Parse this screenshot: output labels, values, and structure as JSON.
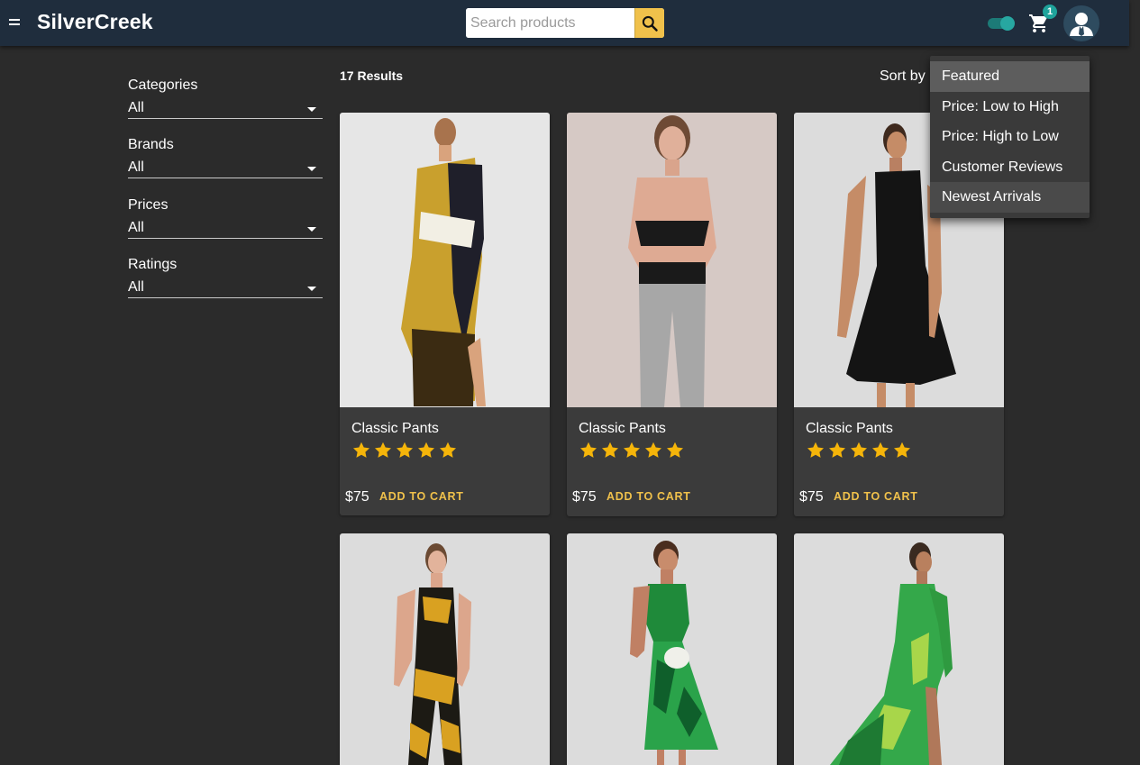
{
  "header": {
    "brand": "SilverCreek",
    "search_placeholder": "Search products",
    "cart_count": "1",
    "toggle_on": true
  },
  "filters": [
    {
      "label": "Categories",
      "value": "All"
    },
    {
      "label": "Brands",
      "value": "All"
    },
    {
      "label": "Prices",
      "value": "All"
    },
    {
      "label": "Ratings",
      "value": "All"
    }
  ],
  "results": {
    "count_text": "17 Results",
    "sort_label": "Sort by"
  },
  "sort_options": [
    {
      "label": "Featured",
      "selected": true
    },
    {
      "label": "Price: Low to High"
    },
    {
      "label": "Price: High to Low"
    },
    {
      "label": "Customer Reviews"
    },
    {
      "label": "Newest Arrivals",
      "hover": true
    }
  ],
  "products": [
    {
      "name": "Classic Pants",
      "price": "$75",
      "rating": 5,
      "cta": "ADD TO CART"
    },
    {
      "name": "Classic Pants",
      "price": "$75",
      "rating": 5,
      "cta": "ADD TO CART"
    },
    {
      "name": "Classic Pants",
      "price": "$75",
      "rating": 5,
      "cta": "ADD TO CART"
    },
    {
      "name": "",
      "price": "",
      "rating": 0,
      "cta": ""
    },
    {
      "name": "",
      "price": "",
      "rating": 0,
      "cta": ""
    },
    {
      "name": "",
      "price": "",
      "rating": 0,
      "cta": ""
    }
  ],
  "colors": {
    "header_bg": "#1f2d3d",
    "page_bg": "#2b2b2b",
    "card_bg": "#3b3b3b",
    "accent": "#f0c14b",
    "star": "#f5b50a",
    "teal": "#1fa39b"
  }
}
